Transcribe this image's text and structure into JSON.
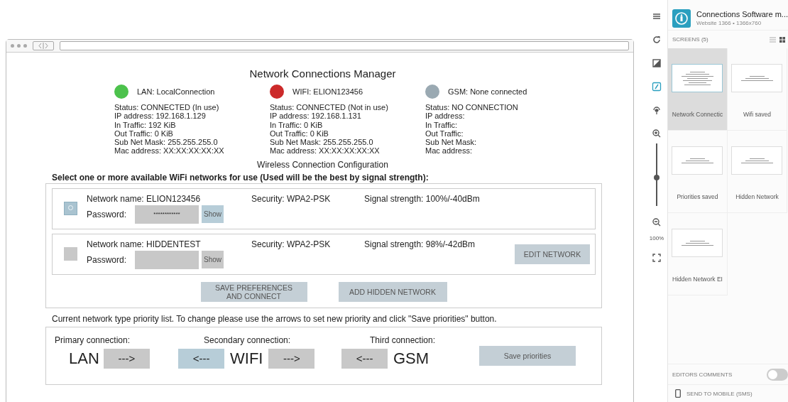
{
  "mockup": {
    "title": "Network Connections Manager",
    "connections": [
      {
        "label": "LAN: LocalConnection",
        "color": "#4cc24c",
        "lines": [
          "Status: CONNECTED (In use)",
          "IP address: 192.168.1.129",
          "In Traffic: 192 KiB",
          "Out Traffic: 0 KiB",
          "Sub Net Mask: 255.255.255.0",
          "Mac address: XX:XX:XX:XX:XX"
        ]
      },
      {
        "label": "WIFI: ELION123456",
        "color": "#cc2a2a",
        "lines": [
          "Status: CONNECTED (Not in use)",
          "IP address: 192.168.1.131",
          "In Traffic: 0 KiB",
          "Out Traffic: 0 KiB",
          "Sub Net Mask: 255.255.255.0",
          "Mac address: XX:XX:XX:XX:XX"
        ]
      },
      {
        "label": "GSM: None connected",
        "color": "#9aa9b2",
        "lines": [
          "Status: NO CONNECTION",
          "IP address:",
          "In Traffic:",
          "Out Traffic:",
          "Sub Net Mask:",
          "Mac address:"
        ]
      }
    ],
    "section_title": "Wireless Connection Configuration",
    "wifi_instruction": "Select one or more available WiFi networks for use (Used will be the best by signal strength):",
    "networks": [
      {
        "checked": true,
        "name": "Network name: ELION123456",
        "security": "Security: WPA2-PSK",
        "signal": "Signal strength: 100%/-40dBm",
        "password_label": "Password:",
        "password": "************",
        "show": "Show"
      },
      {
        "checked": false,
        "name": "Network name: HIDDENTEST",
        "security": "Security: WPA2-PSK",
        "signal": "Signal strength:  98%/-42dBm",
        "password_label": "Password:",
        "show": "Show",
        "edit_button": "EDIT NETWORK"
      }
    ],
    "buttons": [
      "SAVE PREFERENCES AND CONNECT",
      "ADD HIDDEN NETWORK"
    ],
    "priority_instruction": "Current network type priority list. To change please use the arrows to set new priority and click \"Save priorities\" button.",
    "priorities": [
      {
        "heading": "Primary connection:",
        "name": "LAN",
        "arrows": [
          {
            "kind": "right",
            "label": "--->",
            "highlighted": false
          }
        ]
      },
      {
        "heading": "Secondary connection:",
        "name": "WIFI",
        "arrows": [
          {
            "kind": "left",
            "label": "<---",
            "highlighted": true
          },
          {
            "kind": "right",
            "label": "--->",
            "highlighted": false
          }
        ]
      },
      {
        "heading": "Third connection:",
        "name": "GSM",
        "arrows": [
          {
            "kind": "left",
            "label": "<---",
            "highlighted": false
          }
        ]
      }
    ],
    "save_priorities": "Save priorities"
  },
  "toolbar": {
    "zoom": {
      "level": 0.45
    },
    "zoom_reading": "100%"
  },
  "panel": {
    "title": "Connections Software m...",
    "subtitle": "Website 1366 • 1366x760",
    "screens_header": "SCREENS (5)",
    "screens": [
      {
        "label": "Network Connectic",
        "selected": true
      },
      {
        "label": "Wifi saved",
        "selected": false
      },
      {
        "label": "Priorities saved",
        "selected": false
      },
      {
        "label": "Hidden Network",
        "selected": false
      },
      {
        "label": "Hidden Network EI",
        "selected": false
      }
    ],
    "editors_comments": {
      "label": "EDITORS COMMENTS",
      "on": false
    },
    "send_to_mobile": "SEND TO MOBILE (SMS)"
  }
}
